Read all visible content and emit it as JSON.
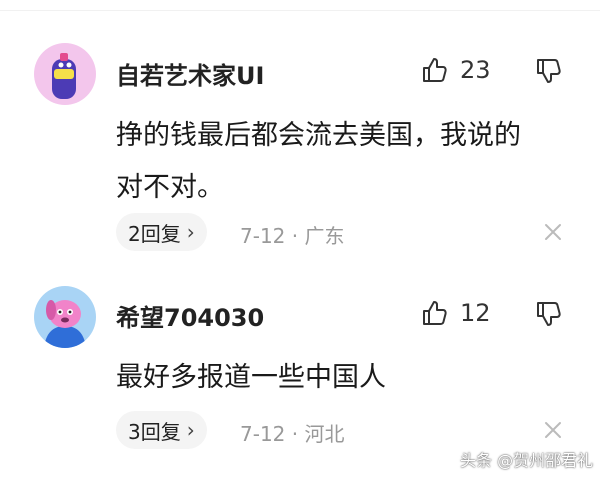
{
  "comments": [
    {
      "username": "自若艺术家UI",
      "likes": "23",
      "text_line1": "挣的钱最后都会流去美国，我说的",
      "text_line2": "对不对。",
      "replies_label": "2回复",
      "meta": "7-12 · 广东",
      "avatar_colors": {
        "bg": "#f3c6ec",
        "figure": "#4c3bb5",
        "accent": "#f5e04a"
      }
    },
    {
      "username": "希望704030",
      "likes": "12",
      "text_line1": "最好多报道一些中国人",
      "replies_label": "3回复",
      "meta": "7-12 · 河北",
      "avatar_colors": {
        "bg": "#a9d4f5",
        "figure": "#f183c9",
        "accent": "#2f6ed8"
      }
    }
  ],
  "reply_chevron": "›",
  "watermark": "头条 @贺州邵君礼",
  "icons": {
    "like": "thumb-up-icon",
    "dislike": "thumb-down-icon",
    "close": "close-icon"
  }
}
